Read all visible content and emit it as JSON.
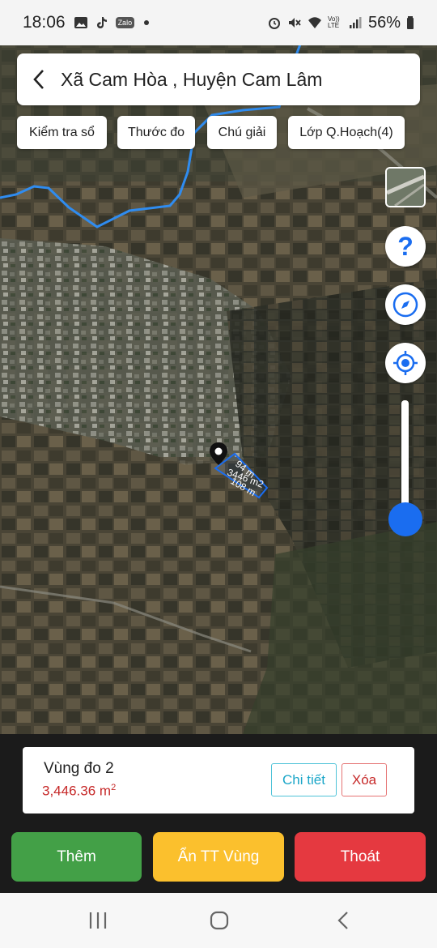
{
  "status_bar": {
    "time": "18:06",
    "battery": "56%",
    "left_icons": [
      "gallery-icon",
      "tiktok-icon",
      "zalo-icon",
      "dot-icon"
    ],
    "zalo_label": "Zalo",
    "right_icons": [
      "alarm-icon",
      "mute-icon",
      "wifi-icon",
      "volte-icon",
      "signal-icon",
      "battery-icon"
    ],
    "volte_label": "Vo))\nLTE"
  },
  "header": {
    "title": "Xã Cam Hòa , Huyện Cam Lâm",
    "back_icon": "chevron-left-icon"
  },
  "chips": [
    {
      "label": "Kiểm tra sổ"
    },
    {
      "label": "Thước đo"
    },
    {
      "label": "Chú giải"
    },
    {
      "label": "Lớp Q.Hoạch(4)"
    }
  ],
  "map_controls": {
    "help_label": "?",
    "icons": [
      "layer-thumbnail",
      "help-icon",
      "compass-icon",
      "locate-icon"
    ],
    "opacity_slider_level": 0.15
  },
  "measurement": {
    "edge_label_1": "94 m",
    "edge_label_2": "108 m",
    "area_label": "3446 m2",
    "edge_extra": "2"
  },
  "result_card": {
    "name": "Vùng đo 2",
    "area_value": "3,446.36 m",
    "area_unit_sup": "2",
    "detail_label": "Chi tiết",
    "delete_label": "Xóa"
  },
  "actions": {
    "add_label": "Thêm",
    "hide_label": "Ẩn TT Vùng",
    "exit_label": "Thoát"
  },
  "colors": {
    "add": "#43a047",
    "hide": "#fbc02d",
    "exit": "#e53940",
    "accent": "#1a6df0",
    "river": "#2f8cf0"
  },
  "nav": [
    "recent-apps-icon",
    "home-icon",
    "back-icon"
  ]
}
